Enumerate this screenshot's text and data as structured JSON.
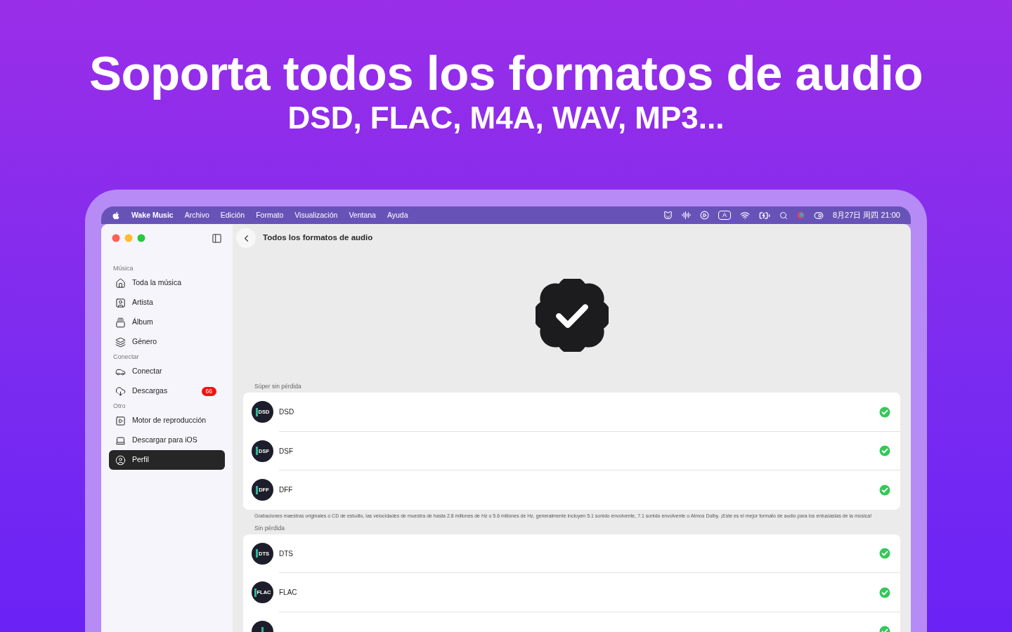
{
  "hero": {
    "title": "Soporta todos los formatos de audio",
    "subtitle": "DSD, FLAC, M4A, WAV, MP3..."
  },
  "menu_bar": {
    "app_name": "Wake Music",
    "menus": [
      "Archivo",
      "Edición",
      "Formato",
      "Visualización",
      "Ventana",
      "Ayuda"
    ],
    "input_source": "A",
    "clock": "8月27日 周四 21:00"
  },
  "sidebar": {
    "sections": [
      {
        "title": "Música",
        "items": [
          {
            "label": "Toda la música",
            "selected": false
          },
          {
            "label": "Artista",
            "selected": false
          },
          {
            "label": "Álbum",
            "selected": false
          },
          {
            "label": "Género",
            "selected": false
          }
        ]
      },
      {
        "title": "Conectar",
        "items": [
          {
            "label": "Conectar",
            "selected": false
          },
          {
            "label": "Descargas",
            "selected": false,
            "badge": "66"
          }
        ]
      },
      {
        "title": "Otro",
        "items": [
          {
            "label": "Motor de reproducción",
            "selected": false
          },
          {
            "label": "Descargar para iOS",
            "selected": false
          },
          {
            "label": "Perfil",
            "selected": true
          }
        ]
      }
    ]
  },
  "page": {
    "title": "Todos los formatos de audio",
    "groups": [
      {
        "title": "Súper sin pérdida",
        "formats": [
          {
            "badge": "DSD",
            "name": "DSD",
            "supported": true
          },
          {
            "badge": "DSF",
            "name": "DSF",
            "supported": true
          },
          {
            "badge": "DFF",
            "name": "DFF",
            "supported": true
          }
        ],
        "note": "Grabaciones maestras originales o CD de estudio, las velocidades de muestra de hasta 2.8 millones de Hz o 5.6 millones de Hz, generalmente incluyen 5.1 sonido envolvente, 7.1 sonido envolvente o Atmos Dolby.  ¡Este es el mejor formato de audio para los entusiastas de la música!"
      },
      {
        "title": "Sin pérdida",
        "formats": [
          {
            "badge": "DTS",
            "name": "DTS",
            "supported": true
          },
          {
            "badge": "FLAC",
            "name": "FLAC",
            "supported": true
          },
          {
            "supported": true
          }
        ]
      }
    ]
  }
}
